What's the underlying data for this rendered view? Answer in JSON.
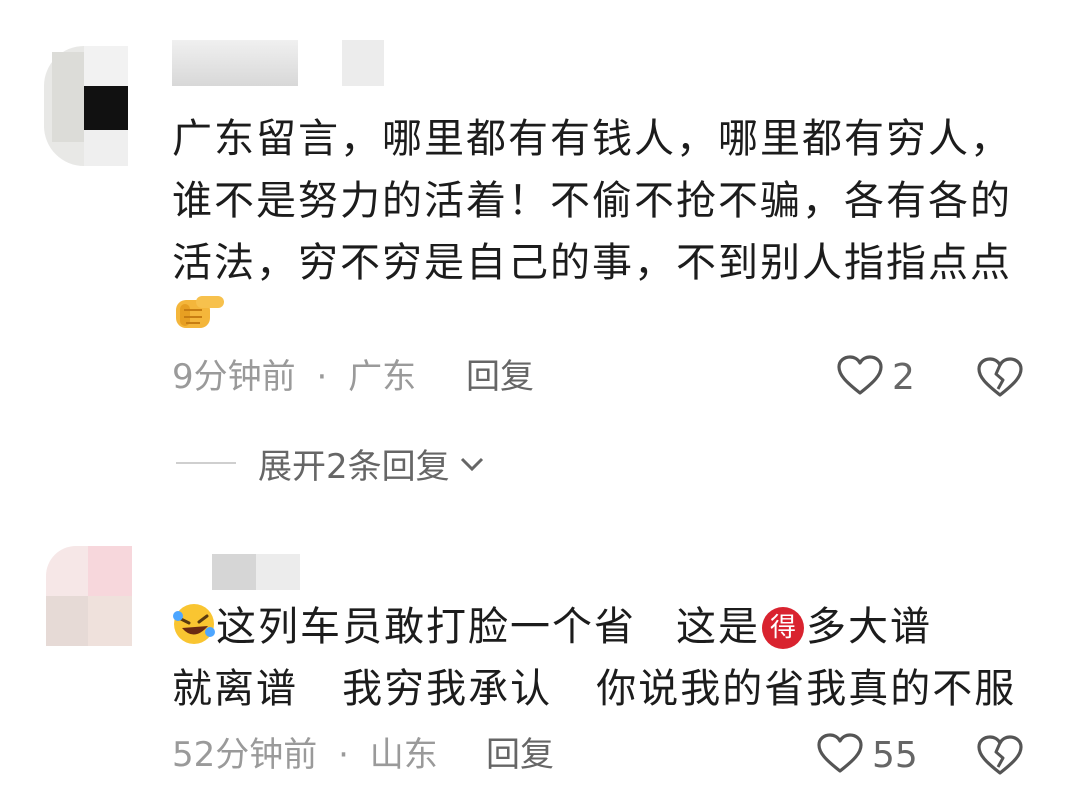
{
  "comments": [
    {
      "text_lines": [
        "广东留言，哪里都有有钱人，哪里都有穷人，",
        "谁不是努力的活着！不偷不抢不骗，各有各的",
        "活法，穷不穷是自己的事，不到别人指指点点"
      ],
      "trailing_emoji": "pointing-hand-emoji",
      "time": "9分钟前",
      "separator": "·",
      "location": "广东",
      "reply_label": "回复",
      "like_count": "2",
      "expand_replies": "展开2条回复"
    },
    {
      "line1_a": "这列车员敢打脸一个省",
      "line1_b": "这是",
      "badge": "得",
      "line1_c": "多大谱",
      "line2": "就离谱   我穷我承认   你说我的省我真的不服",
      "leading_emoji": "rolling-laughing-emoji",
      "time": "52分钟前",
      "separator": "·",
      "location": "山东",
      "reply_label": "回复",
      "like_count": "55"
    }
  ],
  "colors": {
    "text": "#1c1c1c",
    "meta": "#9a9a9a",
    "badge": "#d9232f"
  }
}
